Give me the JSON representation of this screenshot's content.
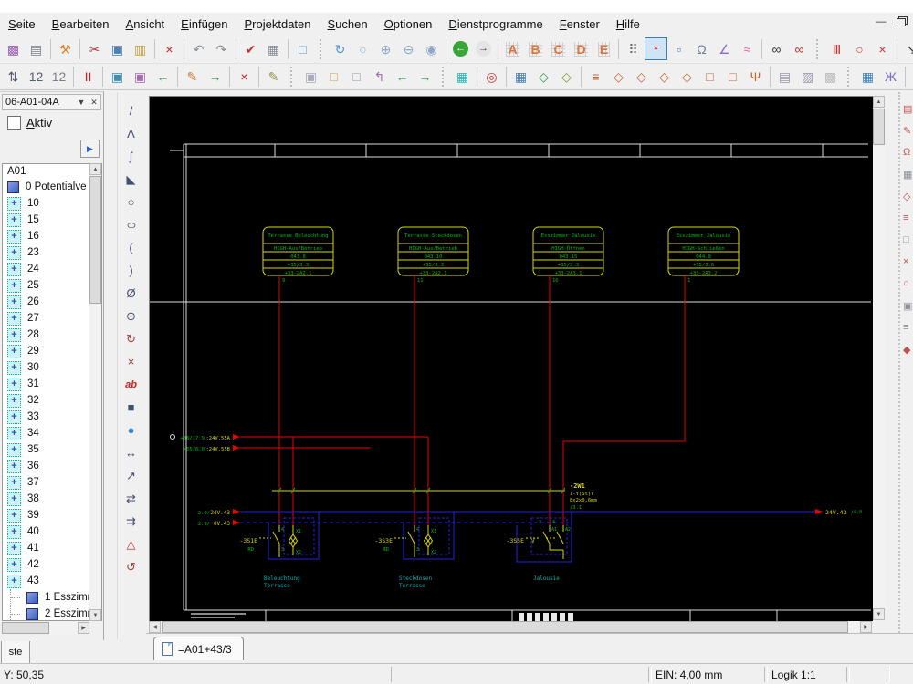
{
  "menubar": {
    "items": [
      "Seite",
      "Bearbeiten",
      "Ansicht",
      "Einfügen",
      "Projektdaten",
      "Suchen",
      "Optionen",
      "Dienstprogramme",
      "Fenster",
      "Hilfe"
    ]
  },
  "toolbar_row1": [
    {
      "n": "page-template-icon",
      "g": "▩",
      "c": "#9a5bb5"
    },
    {
      "n": "print-icon",
      "g": "▤",
      "c": "#7a7f8a"
    },
    {
      "s": 1
    },
    {
      "n": "settings-wrench-icon",
      "g": "⚒",
      "c": "#d9822b"
    },
    {
      "s": 1
    },
    {
      "n": "cut-icon",
      "g": "✂",
      "c": "#b23b3b"
    },
    {
      "n": "copy-icon",
      "g": "▣",
      "c": "#4a7fc0"
    },
    {
      "n": "paste-icon",
      "g": "▥",
      "c": "#c9a13a"
    },
    {
      "s": 1
    },
    {
      "n": "delete-selection-icon",
      "g": "×",
      "c": "#cc2222"
    },
    {
      "s": 1
    },
    {
      "n": "undo-icon",
      "g": "↶",
      "c": "#8a8f98"
    },
    {
      "n": "redo-icon",
      "g": "↷",
      "c": "#8a8f98"
    },
    {
      "s": 1
    },
    {
      "n": "page-check-icon",
      "g": "✔",
      "c": "#c03333"
    },
    {
      "n": "grid-table-icon",
      "g": "▦",
      "c": "#8a8f98"
    },
    {
      "s": 1
    },
    {
      "n": "monitor-icon",
      "g": "□",
      "c": "#5b9bd5"
    },
    {
      "s": 2
    },
    {
      "n": "refresh-icon",
      "g": "↻",
      "c": "#4a90d9"
    },
    {
      "n": "zoom-window-icon",
      "g": "○",
      "c": "#79b8e8"
    },
    {
      "n": "zoom-in-icon",
      "g": "⊕",
      "c": "#8fa8c8"
    },
    {
      "n": "zoom-out-icon",
      "g": "⊖",
      "c": "#8fa8c8"
    },
    {
      "n": "zoom-100-icon",
      "g": "◉",
      "c": "#8fa8c8"
    },
    {
      "s": 1
    },
    {
      "n": "nav-back-icon",
      "g": "←",
      "c": "#ffffff",
      "bg": "#3aa53a"
    },
    {
      "n": "nav-forward-icon",
      "g": "→",
      "c": "#444444",
      "bg": "#e4e4e4"
    },
    {
      "s": 1
    },
    {
      "n": "layer-a-icon",
      "g": "A",
      "c": "#e0733a",
      "grid": 1
    },
    {
      "n": "layer-b-icon",
      "g": "B",
      "c": "#e0733a",
      "grid": 1
    },
    {
      "n": "layer-c-icon",
      "g": "C",
      "c": "#e0733a",
      "grid": 1
    },
    {
      "n": "layer-d-icon",
      "g": "D",
      "c": "#e0733a",
      "grid": 1
    },
    {
      "n": "layer-e-icon",
      "g": "E",
      "c": "#e0733a",
      "grid": 1
    },
    {
      "s": 1
    },
    {
      "n": "grid-dots-icon",
      "g": "⠿",
      "c": "#666666"
    },
    {
      "n": "snap-grid-icon",
      "g": "*",
      "c": "#cc2222",
      "sel": 1
    },
    {
      "n": "snap-object-icon",
      "g": "▫",
      "c": "#4a7fc0"
    },
    {
      "n": "lasso-icon",
      "g": "Ω",
      "c": "#6a7f9a"
    },
    {
      "n": "measure-angle-icon",
      "g": "∠",
      "c": "#8a6ad0"
    },
    {
      "n": "connect-icon",
      "g": "≈",
      "c": "#d06ba0"
    },
    {
      "s": 1
    },
    {
      "n": "search-icon",
      "g": "∞",
      "c": "#333333"
    },
    {
      "n": "search-symbol-icon",
      "g": "∞",
      "c": "#aa3333"
    },
    {
      "s": 2
    },
    {
      "n": "wire-parallel-icon",
      "g": "Ⅲ",
      "c": "#cc3333"
    },
    {
      "n": "wire-circle-icon",
      "g": "○",
      "c": "#cc3333"
    },
    {
      "n": "wire-cross-icon",
      "g": "×",
      "c": "#cc3333"
    },
    {
      "s": 1
    },
    {
      "n": "pointer-icon",
      "g": "↘",
      "c": "#333333"
    },
    {
      "n": "junction-icon",
      "g": "⊙",
      "c": "#3d86c6"
    },
    {
      "s": 2
    },
    {
      "n": "tool-extra-icon",
      "g": "▥",
      "c": "#b8b8b8"
    }
  ],
  "toolbar_row2": [
    {
      "n": "renumber-icon",
      "g": "⇅",
      "c": "#55606e"
    },
    {
      "n": "pin-number-icon",
      "g": "12",
      "c": "#55606e"
    },
    {
      "n": "pin-number2-icon",
      "g": "12",
      "c": "#7a808e"
    },
    {
      "s": 1
    },
    {
      "n": "red-bars-icon",
      "g": "II",
      "c": "#cc2222"
    },
    {
      "s": 1
    },
    {
      "n": "potential-start-icon",
      "g": "▣",
      "c": "#3b8fb8"
    },
    {
      "n": "potential-mid-icon",
      "g": "▣",
      "c": "#a66bb0"
    },
    {
      "n": "potential-end-icon",
      "g": "←",
      "c": "#2a9d4a"
    },
    {
      "s": 1
    },
    {
      "n": "edit-macro-icon",
      "g": "✎",
      "c": "#c87a2e"
    },
    {
      "n": "insert-macro-icon",
      "g": "→",
      "c": "#2a9d4a"
    },
    {
      "s": 1
    },
    {
      "n": "delete-macro-icon",
      "g": "×",
      "c": "#cc2222"
    },
    {
      "s": 1
    },
    {
      "n": "macro-tools-icon",
      "g": "✎",
      "c": "#9a8f4a"
    },
    {
      "s": 2
    },
    {
      "n": "copy-page-icon",
      "g": "▣",
      "c": "#aaaabb"
    },
    {
      "n": "new-page-icon",
      "g": "□",
      "c": "#c9a13a"
    },
    {
      "n": "open-page-icon",
      "g": "□",
      "c": "#9999aa"
    },
    {
      "n": "import-page-icon",
      "g": "↰",
      "c": "#a66bb0"
    },
    {
      "n": "prev-page-icon",
      "g": "←",
      "c": "#2a9d4a"
    },
    {
      "n": "next-page-icon",
      "g": "→",
      "c": "#2a9d4a"
    },
    {
      "s": 2
    },
    {
      "n": "select-area-icon",
      "g": "▦",
      "c": "#2ab8b8"
    },
    {
      "s": 1
    },
    {
      "n": "ref-circle-icon",
      "g": "◎",
      "c": "#cc3333"
    },
    {
      "s": 1
    },
    {
      "n": "select-frame-icon",
      "g": "▦",
      "c": "#4a7fc0"
    },
    {
      "n": "select-symbol-icon",
      "g": "◇",
      "c": "#2a9d4a"
    },
    {
      "n": "select-symbol2-icon",
      "g": "◇",
      "c": "#7a9d2a"
    },
    {
      "s": 1
    },
    {
      "n": "terminal-row-icon",
      "g": "≡",
      "c": "#cc6633"
    },
    {
      "n": "terminal-icon",
      "g": "◇",
      "c": "#cc6633"
    },
    {
      "n": "terminal-down-icon",
      "g": "◇",
      "c": "#cc6633"
    },
    {
      "n": "terminal-angle-icon",
      "g": "◇",
      "c": "#cc6633"
    },
    {
      "n": "terminal-up-icon",
      "g": "◇",
      "c": "#cc6633"
    },
    {
      "n": "terminal-box-icon",
      "g": "□",
      "c": "#cc6633"
    },
    {
      "n": "terminal-box2-icon",
      "g": "□",
      "c": "#cc6633"
    },
    {
      "n": "terminal-multi-icon",
      "g": "Ψ",
      "c": "#cc6633"
    },
    {
      "s": 1
    },
    {
      "n": "page-props-icon",
      "g": "▤",
      "c": "#9999aa"
    },
    {
      "n": "hatch-icon",
      "g": "▨",
      "c": "#9999aa"
    },
    {
      "n": "select-new-icon",
      "g": "▩",
      "c": "#bbbbbb"
    },
    {
      "s": 2
    },
    {
      "n": "table-view-icon",
      "g": "▦",
      "c": "#3d86c6"
    },
    {
      "n": "connector-icon",
      "g": "Ж",
      "c": "#7a6ad0"
    },
    {
      "s": 1
    },
    {
      "n": "cart-icon",
      "g": "⊔",
      "c": "#4a5fc0"
    },
    {
      "n": "search-parts-icon",
      "g": "∞",
      "c": "#bb3333"
    }
  ],
  "draw_tools": [
    {
      "n": "line-tool-icon",
      "g": "/",
      "c": "#44506a"
    },
    {
      "n": "polyline-tool-icon",
      "g": "Λ",
      "c": "#44506a"
    },
    {
      "n": "bezier-tool-icon",
      "g": "ʃ",
      "c": "#44506a"
    },
    {
      "n": "polygon-tool-icon",
      "g": "◣",
      "c": "#44506a"
    },
    {
      "n": "circle-tool-icon",
      "g": "○",
      "c": "#44506a"
    },
    {
      "n": "ellipse-tool-icon",
      "g": "○",
      "c": "#44506a",
      "wide": 1
    },
    {
      "n": "arc-left-tool-icon",
      "g": "(",
      "c": "#44506a"
    },
    {
      "n": "arc-right-tool-icon",
      "g": ")",
      "c": "#44506a"
    },
    {
      "n": "pie-tool-icon",
      "g": "Ø",
      "c": "#44506a"
    },
    {
      "n": "clock-tool-icon",
      "g": "⊙",
      "c": "#44506a"
    },
    {
      "n": "rotate-tool-icon",
      "g": "↻",
      "c": "#a33b3b"
    },
    {
      "n": "cross-tool-icon",
      "g": "×",
      "c": "#a33b3b"
    },
    {
      "n": "text-tool-icon",
      "g": "ab",
      "c": "#cc2222",
      "it": 1
    },
    {
      "n": "fill-tool-icon",
      "g": "■",
      "c": "#44506a"
    },
    {
      "n": "web-tool-icon",
      "g": "●",
      "c": "#3d86c6"
    },
    {
      "n": "span-tool-icon",
      "g": "↔",
      "c": "#44506a"
    },
    {
      "n": "diag-arrow-tool-icon",
      "g": "↗",
      "c": "#44506a"
    },
    {
      "n": "dimension-tool-icon",
      "g": "⇄",
      "c": "#44506a"
    },
    {
      "n": "dimension-chain-tool-icon",
      "g": "⇉",
      "c": "#44506a"
    },
    {
      "n": "warn-tool-icon",
      "g": "△",
      "c": "#cc3333"
    },
    {
      "n": "arc-arrow-tool-icon",
      "g": "↺",
      "c": "#a33b3b"
    }
  ],
  "right_tools": [
    {
      "n": "right-tool-symbols-icon",
      "g": "▤",
      "c": "#c05050"
    },
    {
      "n": "right-tool-edit-icon",
      "g": "✎",
      "c": "#c05050"
    },
    {
      "n": "right-tool-omega-icon",
      "g": "Ω",
      "c": "#c05050"
    },
    {
      "n": "right-tool-grid-icon",
      "g": "▦",
      "c": "#8a8f98"
    },
    {
      "n": "right-tool-diamond-icon",
      "g": "◇",
      "c": "#c05050"
    },
    {
      "n": "right-tool-rows-icon",
      "g": "≡",
      "c": "#c05050"
    },
    {
      "n": "right-tool-box-icon",
      "g": "□",
      "c": "#8a8f98"
    },
    {
      "n": "right-tool-cross-icon",
      "g": "×",
      "c": "#c05050"
    },
    {
      "n": "right-tool-circle-icon",
      "g": "○",
      "c": "#c05050"
    },
    {
      "n": "right-tool-chip-icon",
      "g": "▣",
      "c": "#8a8f98"
    },
    {
      "n": "right-tool-lines-icon",
      "g": "≡",
      "c": "#8a8f98"
    },
    {
      "n": "right-tool-dot-icon",
      "g": "◆",
      "c": "#c05050"
    }
  ],
  "panel": {
    "combo_value": "06-A01-04A",
    "aktiv_label": "Aktiv",
    "group_header": "A01",
    "tree_items": [
      "0 Potentialve",
      "10",
      "15",
      "16",
      "23",
      "24",
      "25",
      "26",
      "27",
      "28",
      "29",
      "30",
      "31",
      "32",
      "33",
      "34",
      "35",
      "36",
      "37",
      "38",
      "39",
      "40",
      "41",
      "42",
      "43"
    ],
    "sub_items": [
      "1 Esszimm",
      "2 Esszimm"
    ],
    "bottom_tab": "ste"
  },
  "schematic": {
    "function_boxes": [
      {
        "title": "Terrasse Beleuchtung",
        "signal": "HIGH-Aus/Betrieb",
        "address": "043.8",
        "ref1": "+35/3.3",
        "ref2": "+33-2A2.1",
        "pin": "9"
      },
      {
        "title": "Terrasse Steckdosen",
        "signal": "HIGH-Aus/Betrieb",
        "address": "043.10",
        "ref1": "+35/3.3",
        "ref2": "+33-2A2.1",
        "pin": "11"
      },
      {
        "title": "Esszimmer Jalousie",
        "signal": "HIGH-Öffnen",
        "address": "043.15",
        "ref1": "+35/3.3",
        "ref2": "+33-2A3.1",
        "pin": "16"
      },
      {
        "title": "Esszimmer Jalousie",
        "signal": "HIGH-Schließen",
        "address": "044.0",
        "ref1": "+35/3.6",
        "ref2": "+33-2A3.2",
        "pin": "1"
      }
    ],
    "supply_refs": [
      {
        "ref": "+36/17.9",
        "label": ":24V.55A"
      },
      {
        "ref": "+55/6.0",
        "label": ":24V.55B"
      }
    ],
    "bus_refs": [
      {
        "ref": "2.9/",
        "label": "24V.43"
      },
      {
        "ref": "2.9/",
        "label": "0V.43"
      }
    ],
    "bus_out": {
      "label": "24V.43",
      "ref": "/4.0"
    },
    "cable": {
      "name": "-2W1",
      "type": "1-Y(St)Y",
      "spec": "8x2x0,6mm",
      "ref": "/3.1"
    },
    "switches": [
      {
        "name": "-3S1E",
        "color": "RD",
        "t_top": "4",
        "t_bot": "3",
        "lamp_top": "X1",
        "lamp_bot": "X2"
      },
      {
        "name": "-3S3E",
        "color": "RD",
        "t_top": "4",
        "t_bot": "3",
        "lamp_top": "X1",
        "lamp_bot": "X2"
      },
      {
        "name": "-3S5E",
        "actuator": "V",
        "terminals": [
          "2",
          "4",
          "A1",
          "A2"
        ]
      }
    ],
    "captions": [
      [
        "Beleuchtung",
        "Terrasse"
      ],
      [
        "Steckdosen",
        "Terrasse"
      ],
      [
        "Jalousie",
        ""
      ]
    ]
  },
  "page_tab": "=A01+43/3",
  "statusbar": {
    "coord": "Y:  50,35",
    "grid": "EIN: 4,00 mm",
    "scale": "Logik 1:1"
  }
}
